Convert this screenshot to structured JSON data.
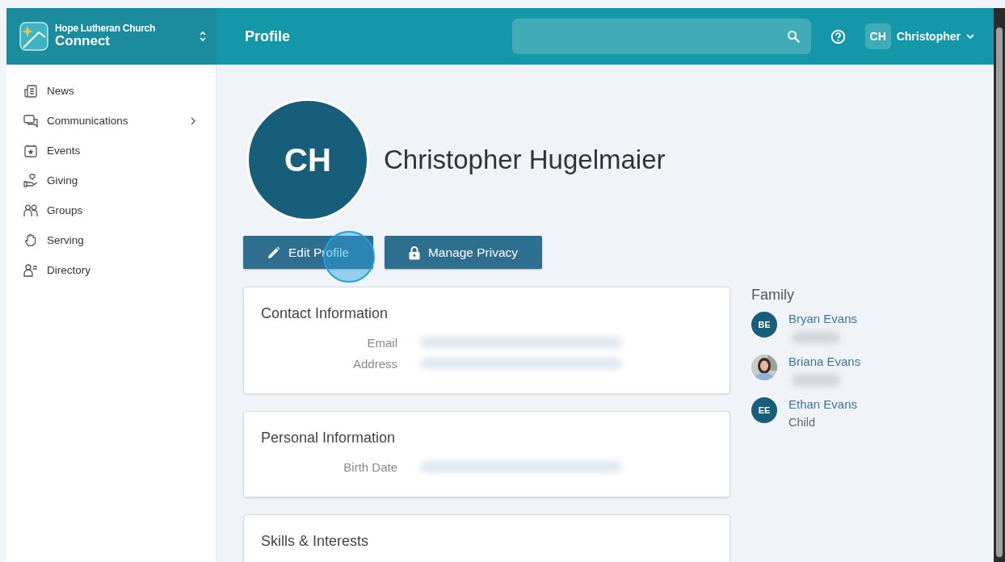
{
  "brand": {
    "org": "Hope Lutheran Church",
    "app": "Connect"
  },
  "header": {
    "title": "Profile",
    "user_initials": "CH",
    "user_name": "Christopher"
  },
  "sidebar": {
    "items": [
      {
        "label": "News",
        "has_submenu": false
      },
      {
        "label": "Communications",
        "has_submenu": true
      },
      {
        "label": "Events",
        "has_submenu": false
      },
      {
        "label": "Giving",
        "has_submenu": false
      },
      {
        "label": "Groups",
        "has_submenu": false
      },
      {
        "label": "Serving",
        "has_submenu": false
      },
      {
        "label": "Directory",
        "has_submenu": false
      }
    ]
  },
  "profile": {
    "initials": "CH",
    "name": "Christopher Hugelmaier"
  },
  "actions": [
    {
      "label": "Edit Profile",
      "clicked": true
    },
    {
      "label": "Manage Privacy",
      "clicked": false
    }
  ],
  "cards": [
    {
      "title": "Contact Information",
      "fields": [
        {
          "label": "Email",
          "blurred": true
        },
        {
          "label": "Address",
          "blurred": true
        }
      ]
    },
    {
      "title": "Personal Information",
      "fields": [
        {
          "label": "Birth Date",
          "blurred": true
        }
      ]
    },
    {
      "title": "Skills & Interests"
    }
  ],
  "family": {
    "title": "Family",
    "members": [
      {
        "kind": "initials",
        "initials": "BE",
        "name": "Bryan Evans",
        "detail_blurred": true
      },
      {
        "name": "Briana Evans",
        "detail_blurred": true
      },
      {
        "kind": "initials",
        "initials": "EE",
        "name": "Ethan Evans",
        "relation": "Child",
        "detail_blurred": false
      }
    ]
  }
}
